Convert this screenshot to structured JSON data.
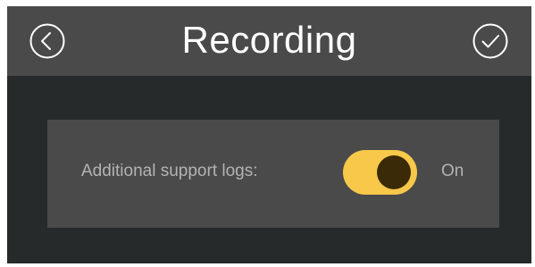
{
  "header": {
    "title": "Recording",
    "back_icon": "circle-chevron-left-icon",
    "confirm_icon": "circle-check-icon"
  },
  "settings": [
    {
      "label": "Additional support logs:",
      "enabled": true,
      "state_label": "On"
    }
  ],
  "colors": {
    "background": "#262a2a",
    "header": "#4a4a4a",
    "panel": "#4a4a4a",
    "toggle_track": "#f7c84a",
    "toggle_knob": "#3a2a08",
    "label_text": "#b3b3b3",
    "title_text": "#ffffff"
  }
}
